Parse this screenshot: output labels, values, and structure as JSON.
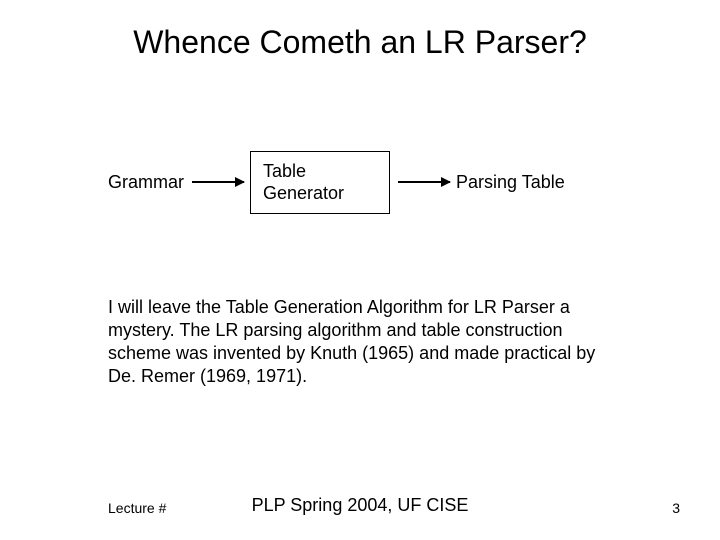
{
  "title": "Whence Cometh an LR Parser?",
  "diagram": {
    "grammar": "Grammar",
    "table_generator": "Table\nGenerator",
    "parsing_table": "Parsing Table"
  },
  "body": "I will leave the Table Generation Algorithm for LR Parser a mystery.  The LR parsing algorithm and table construction scheme was invented by Knuth (1965) and made practical by De. Remer (1969, 1971).",
  "footer": {
    "left": "Lecture #",
    "center": "PLP Spring 2004, UF CISE",
    "page": "3"
  }
}
